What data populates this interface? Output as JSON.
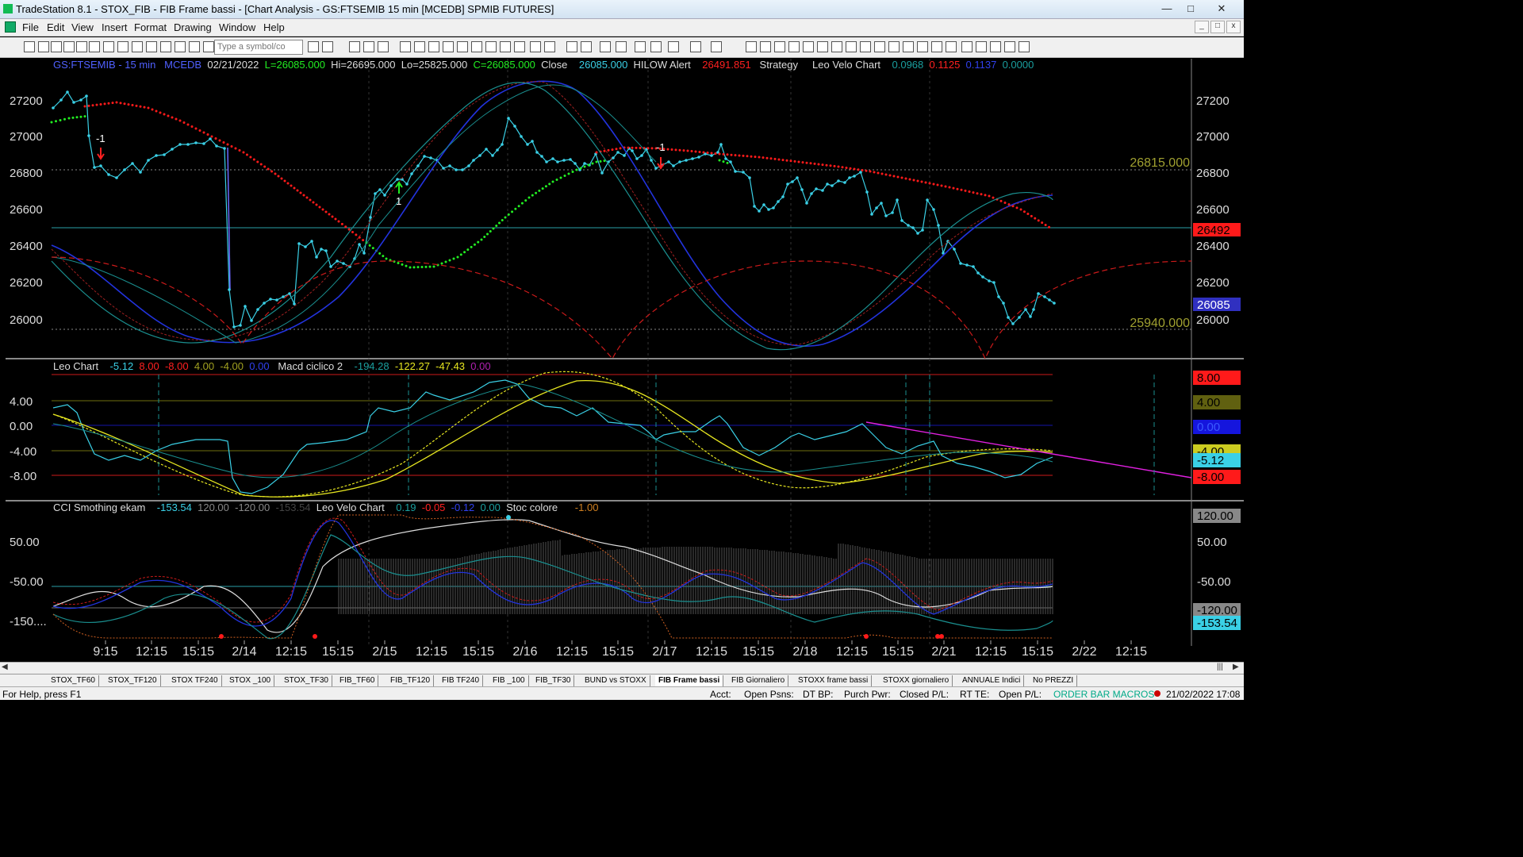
{
  "window": {
    "title": "TradeStation 8.1 - STOX_FIB - FIB Frame bassi - [Chart Analysis - GS:FTSEMIB  15 min  [MCEDB] SPMIB FUTURES]"
  },
  "menu": [
    "File",
    "Edit",
    "View",
    "Insert",
    "Format",
    "Drawing",
    "Window",
    "Help"
  ],
  "toolbar": {
    "symbol_placeholder": "Type a symbol/co"
  },
  "header1": {
    "symbol": "GS:FTSEMIB - 15 min",
    "feed": "MCEDB",
    "date": "02/21/2022",
    "last": "L=26085.000",
    "hi": "Hi=26695.000",
    "lo": "Lo=25825.000",
    "close": "C=26085.000",
    "close_label": "Close",
    "close_val": "26085.000",
    "hilow": "HILOW Alert",
    "hilow_val": "26491.851",
    "strategy": "Strategy",
    "leo": "Leo Velo Chart",
    "v1": "0.0968",
    "v2": "0.1125",
    "v3": "0.1137",
    "v4": "0.0000"
  },
  "header2": {
    "leo": "Leo Chart",
    "a": "-5.12",
    "b": "8.00",
    "c": "-8.00",
    "d": "4.00",
    "e": "-4.00",
    "f": "0.00",
    "macd": "Macd ciclico 2",
    "g": "-194.28",
    "h": "-122.27",
    "i": "-47.43",
    "j": "0.00"
  },
  "header3": {
    "cci": "CCI Smothing ekam",
    "a": "-153.54",
    "b": "120.00",
    "c": "-120.00",
    "d": "-153.54",
    "leo": "Leo Velo Chart",
    "e": "0.19",
    "f": "-0.05",
    "g": "-0.12",
    "h": "0.00",
    "stoc": "Stoc colore",
    "i": "-1.00"
  },
  "price_axis": [
    "27200",
    "27000",
    "26800",
    "26600",
    "26400",
    "26200",
    "26000"
  ],
  "price_tags": {
    "upper": "26815.000",
    "lower": "25940.000",
    "hilow": "26492",
    "last": "26085"
  },
  "macd_axis": [
    "4.00",
    "0.00",
    "-4.00",
    "-8.00"
  ],
  "macd_tags": [
    "8.00",
    "4.00",
    "0.00",
    "-4.00",
    "-5.12",
    "-8.00"
  ],
  "cci_axis": [
    "50.00",
    "-50.00",
    "-150...."
  ],
  "cci_tags": [
    "120.00",
    "50.00",
    "-50.00",
    "-120.00",
    "-153.54"
  ],
  "time_axis": [
    "9:15",
    "12:15",
    "15:15",
    "2/14",
    "12:15",
    "15:15",
    "2/15",
    "12:15",
    "15:15",
    "2/16",
    "12:15",
    "15:15",
    "2/17",
    "12:15",
    "15:15",
    "2/18",
    "12:15",
    "15:15",
    "2/21",
    "12:15",
    "15:15",
    "2/22",
    "12:15"
  ],
  "annotations": {
    "sell1": "-1",
    "buy1": "1",
    "sell2": "-1"
  },
  "tabs": [
    "STOX_TF60",
    "STOX_TF120",
    "STOX TF240",
    "STOX _100",
    "STOX_TF30",
    "FIB_TF60",
    "FIB_TF120",
    "FIB TF240",
    "FIB _100",
    "FIB_TF30",
    "BUND vs STOXX",
    "FIB Frame bassi",
    "FIB Giornaliero",
    "STOXX frame bassi",
    "STOXX giornaliero",
    "ANNUALE Indici",
    "No PREZZI"
  ],
  "status": {
    "help": "For Help, press F1",
    "acct": "Acct:",
    "psns": "Open Psns:",
    "dtbp": "DT BP:",
    "purch": "Purch Pwr:",
    "closed": "Closed P/L:",
    "rtte": "RT TE:",
    "open": "Open P/L:",
    "order": "ORDER BAR  MACROS",
    "time": "21/02/2022 17:08"
  },
  "colors": {
    "bg": "#000000",
    "price": "#3ad0e6",
    "red_dots": "#ff1a1a",
    "green_dots": "#22ee22",
    "blue": "#2233dd",
    "teal": "#1a8f8f"
  }
}
